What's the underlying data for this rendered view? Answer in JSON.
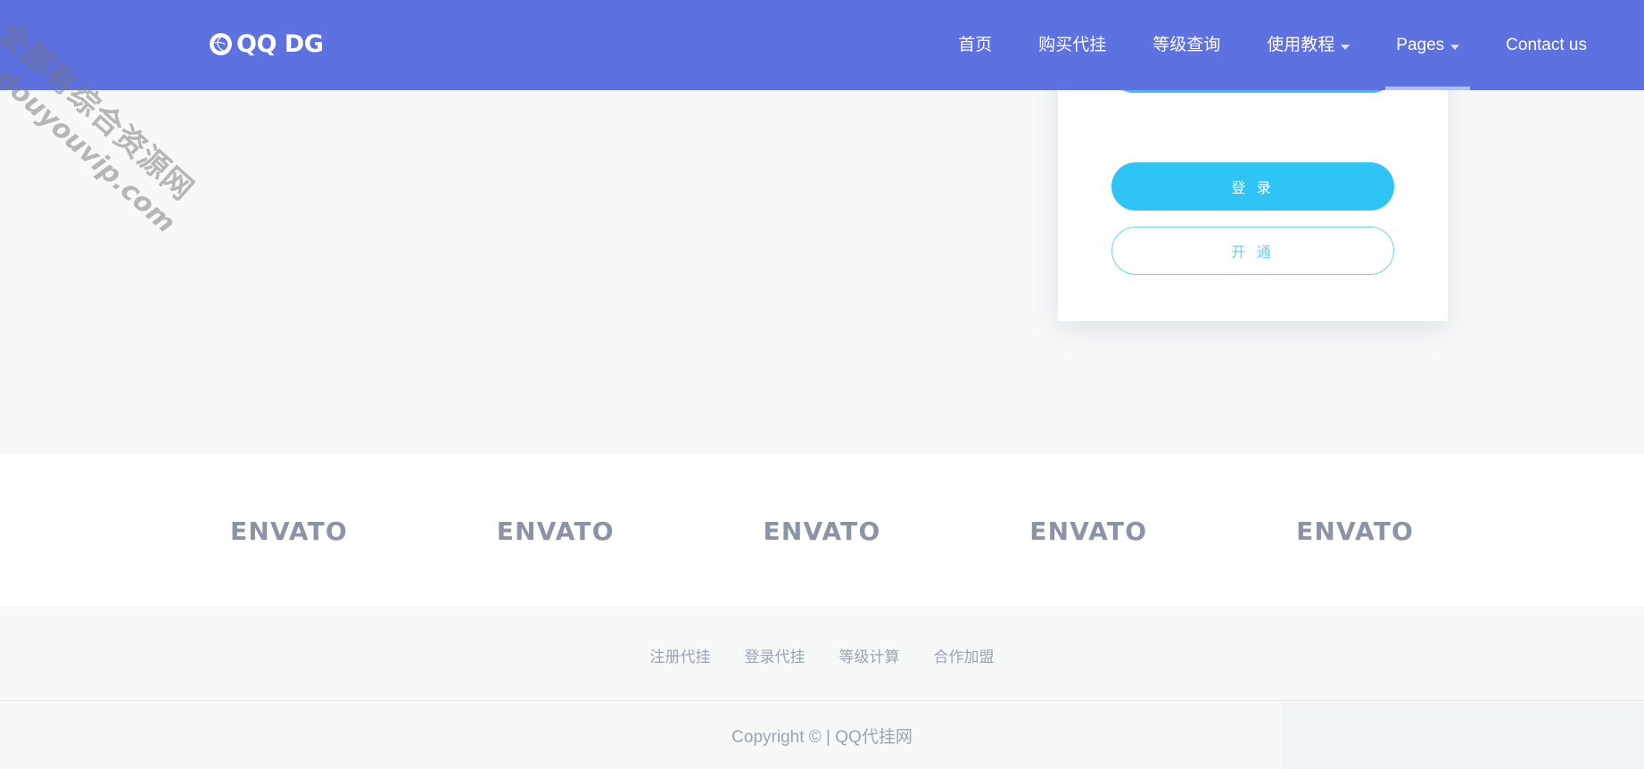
{
  "colors": {
    "header_bg": "#5d71e0",
    "page_bg": "#f7f9f9",
    "card_bg": "#ffffff",
    "accent_cyan": "#2ec5f6",
    "accent_cyan_border": "#6ed0f7",
    "muted_text": "#9aa3b2",
    "partner_text": "#8b93a7"
  },
  "header": {
    "brand": {
      "icon": "globe-icon",
      "text": "QQ DG"
    },
    "nav": [
      {
        "label": "首页",
        "has_caret": false,
        "active": false
      },
      {
        "label": "购买代挂",
        "has_caret": false,
        "active": false
      },
      {
        "label": "等级查询",
        "has_caret": false,
        "active": false
      },
      {
        "label": "使用教程",
        "has_caret": true,
        "active": false
      },
      {
        "label": "Pages",
        "has_caret": true,
        "active": true
      },
      {
        "label": "Contact us",
        "has_caret": false,
        "active": false
      }
    ]
  },
  "hero": {
    "buttons": [
      {
        "label": ""
      },
      {
        "label": ""
      }
    ]
  },
  "login_card": {
    "top_button_label": "",
    "login_label": "登 录",
    "activate_label": "开 通"
  },
  "partners": {
    "logos": [
      {
        "label": "ENVATO"
      },
      {
        "label": "ENVATO"
      },
      {
        "label": "ENVATO"
      },
      {
        "label": "ENVATO"
      },
      {
        "label": "ENVATO"
      }
    ]
  },
  "footer": {
    "links": [
      {
        "label": "注册代挂"
      },
      {
        "label": "登录代挂"
      },
      {
        "label": "等级计算"
      },
      {
        "label": "合作加盟"
      }
    ],
    "copyright": "Copyright © | QQ代挂网"
  },
  "watermark": {
    "line_cn": "全部有综合资源网",
    "line_en": "douyouvip.com"
  }
}
